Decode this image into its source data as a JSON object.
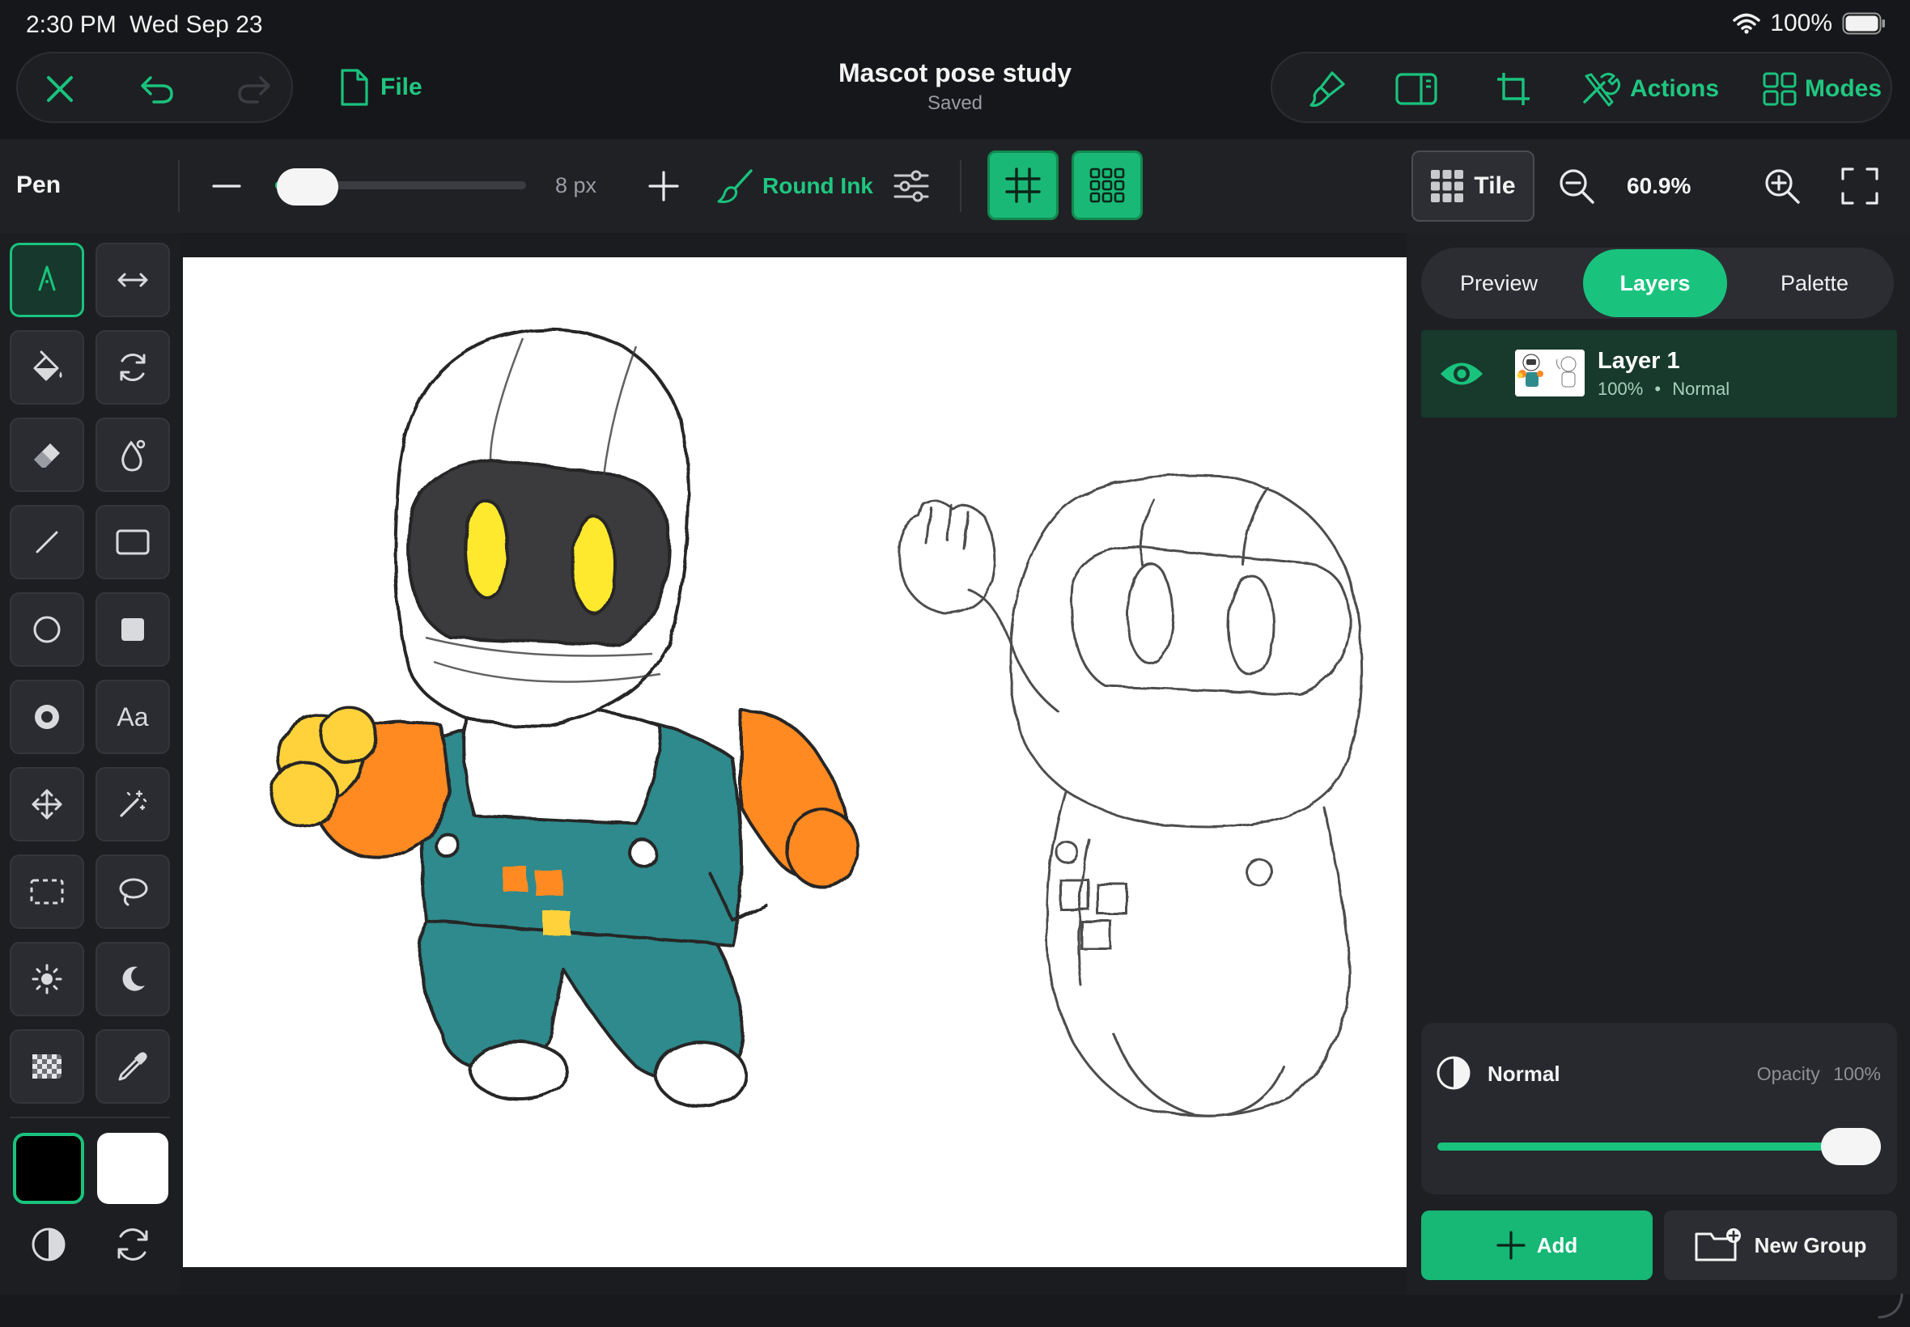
{
  "status": {
    "time": "2:30 PM",
    "date": "Wed Sep 23",
    "battery": "100%"
  },
  "titlebar": {
    "file_label": "File",
    "document_title": "Mascot pose study",
    "document_status": "Saved",
    "actions_label": "Actions",
    "modes_label": "Modes"
  },
  "tool_options": {
    "tool_name": "Pen",
    "brush_size": "8 px",
    "brush_size_fraction": 0.03,
    "brush_name": "Round Ink",
    "tile_label": "Tile",
    "zoom": "60.9%"
  },
  "toolbar": {
    "tools": [
      "pen",
      "flip-horizontal",
      "fill-bucket",
      "rotate",
      "eraser",
      "blur-drop",
      "line",
      "rectangle",
      "ellipse",
      "filled-square",
      "radial",
      "text",
      "move",
      "magic-wand",
      "rect-select",
      "lasso-select",
      "brightness",
      "dark-mode",
      "checker-pattern",
      "eyedropper"
    ],
    "text_tool_label": "Aa",
    "primary_color": "#000000",
    "secondary_color": "#ffffff"
  },
  "panel": {
    "tabs": [
      {
        "label": "Preview"
      },
      {
        "label": "Layers"
      },
      {
        "label": "Palette"
      }
    ],
    "active_tab": "Layers",
    "layers": [
      {
        "name": "Layer 1",
        "opacity": "100%",
        "blend": "Normal",
        "visible": true
      }
    ],
    "layer_separator": "•",
    "blend_mode": "Normal",
    "opacity_label": "Opacity",
    "opacity_value": "100%",
    "opacity_fraction": 1.0,
    "add_label": "Add",
    "new_group_label": "New Group"
  },
  "colors": {
    "accent": "#19c37d",
    "background": "#18191c",
    "helmet_visor": "#3a3a3c",
    "eyes": "#ffe92e",
    "overalls": "#2f8a8c",
    "arms": "#ff8a24",
    "fist": "#ffd23a"
  }
}
